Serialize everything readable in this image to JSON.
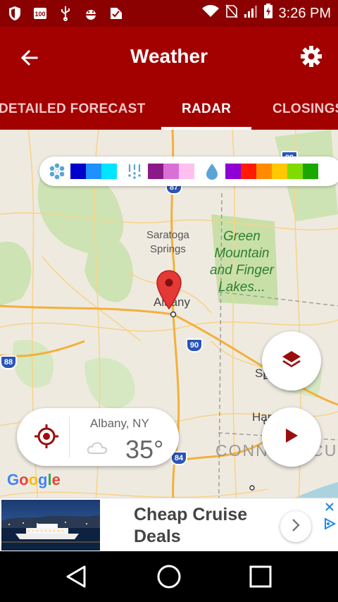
{
  "status_bar": {
    "time": "3:26 PM",
    "icons": [
      "shield-icon",
      "badge-100-icon",
      "usb-icon",
      "android-debug-icon",
      "clipboard-check-icon",
      "wifi-icon",
      "no-sim-icon",
      "signal-icon",
      "battery-charging-icon"
    ]
  },
  "appbar": {
    "title": "Weather",
    "back_icon": "back-arrow-icon",
    "settings_icon": "gear-icon"
  },
  "tabs": [
    {
      "label": "DETAILED FORECAST",
      "active": false
    },
    {
      "label": "RADAR",
      "active": true
    },
    {
      "label": "CLOSINGS",
      "active": false
    }
  ],
  "legend": {
    "groups": [
      {
        "icon": "snow-icon",
        "colors": [
          "#0000cd",
          "#1e90ff",
          "#00e5ff"
        ]
      },
      {
        "icon": "sleet-icon",
        "colors": [
          "#8b1a89",
          "#da70d6",
          "#ffc0f0"
        ]
      },
      {
        "icon": "rain-drop-icon",
        "colors": [
          "#8e00d6",
          "#ff1a00",
          "#ff8c00",
          "#ffc800",
          "#7fdb00",
          "#1aa800"
        ]
      }
    ]
  },
  "map": {
    "labels": {
      "saratoga": "Saratoga\nSprings",
      "albany": "Albany",
      "green_mountain": "Green\nMountain\nand Finger\nLakes...",
      "springfield_partial": "Sp",
      "hartford_partial": "Har",
      "connecticut": "CONNECTICUT"
    },
    "highway_shields": {
      "i87": "87",
      "i90": "90",
      "i88": "88",
      "i84": "84",
      "i89": "89"
    }
  },
  "location_card": {
    "city": "Albany, NY",
    "temperature": "35°",
    "condition_icon": "cloud-icon",
    "locate_icon": "target-icon"
  },
  "buttons": {
    "layers_icon": "layers-icon",
    "play_icon": "play-icon"
  },
  "google": {
    "letters": [
      "G",
      "o",
      "o",
      "g",
      "l",
      "e"
    ],
    "colors": [
      "#4285f4",
      "#ea4335",
      "#fbbc05",
      "#4285f4",
      "#34a853",
      "#ea4335"
    ]
  },
  "ad": {
    "headline": "Cheap Cruise Deals",
    "close_icon": "close-icon",
    "adchoices_icon": "adchoices-icon",
    "arrow_icon": "chevron-right-icon"
  },
  "colors": {
    "status_bar": "#8b0000",
    "appbar": "#a30000",
    "accent_red": "#9b0d0d"
  },
  "nav": {
    "back": "nav-back-icon",
    "home": "nav-home-icon",
    "recents": "nav-recents-icon"
  }
}
